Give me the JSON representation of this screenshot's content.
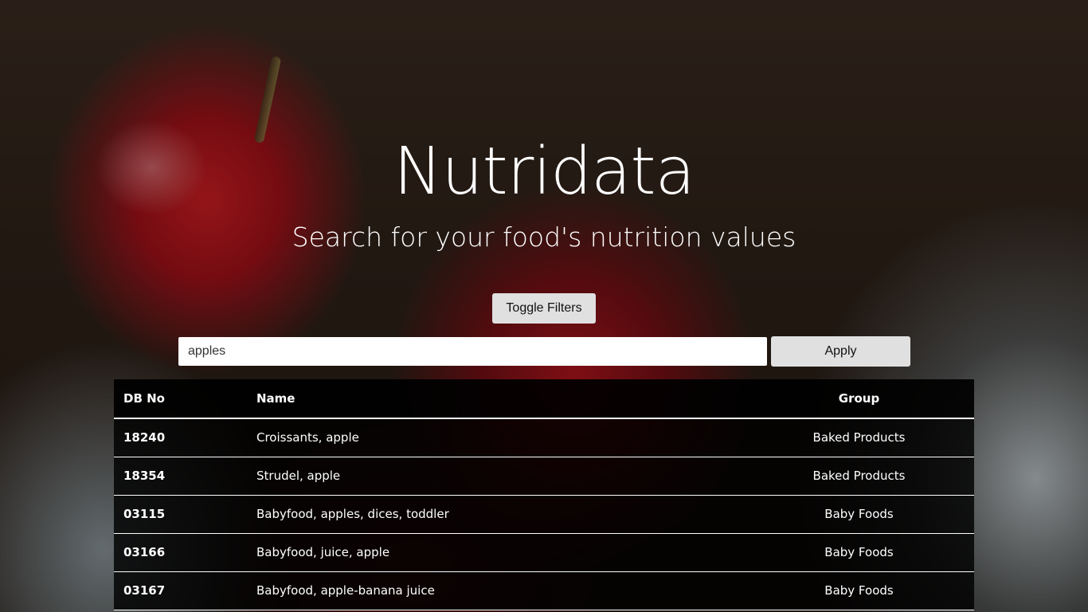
{
  "header": {
    "title": "Nutridata",
    "subtitle": "Search for your food's nutrition values"
  },
  "filters": {
    "toggle_label": "Toggle Filters"
  },
  "search": {
    "value": "apples",
    "placeholder": "",
    "apply_label": "Apply"
  },
  "table": {
    "columns": [
      "DB No",
      "Name",
      "Group"
    ],
    "rows": [
      {
        "db_no": "18240",
        "name": "Croissants, apple",
        "group": "Baked Products"
      },
      {
        "db_no": "18354",
        "name": "Strudel, apple",
        "group": "Baked Products"
      },
      {
        "db_no": "03115",
        "name": "Babyfood, apples, dices, toddler",
        "group": "Baby Foods"
      },
      {
        "db_no": "03166",
        "name": "Babyfood, juice, apple",
        "group": "Baby Foods"
      },
      {
        "db_no": "03167",
        "name": "Babyfood, apple-banana juice",
        "group": "Baby Foods"
      }
    ]
  }
}
